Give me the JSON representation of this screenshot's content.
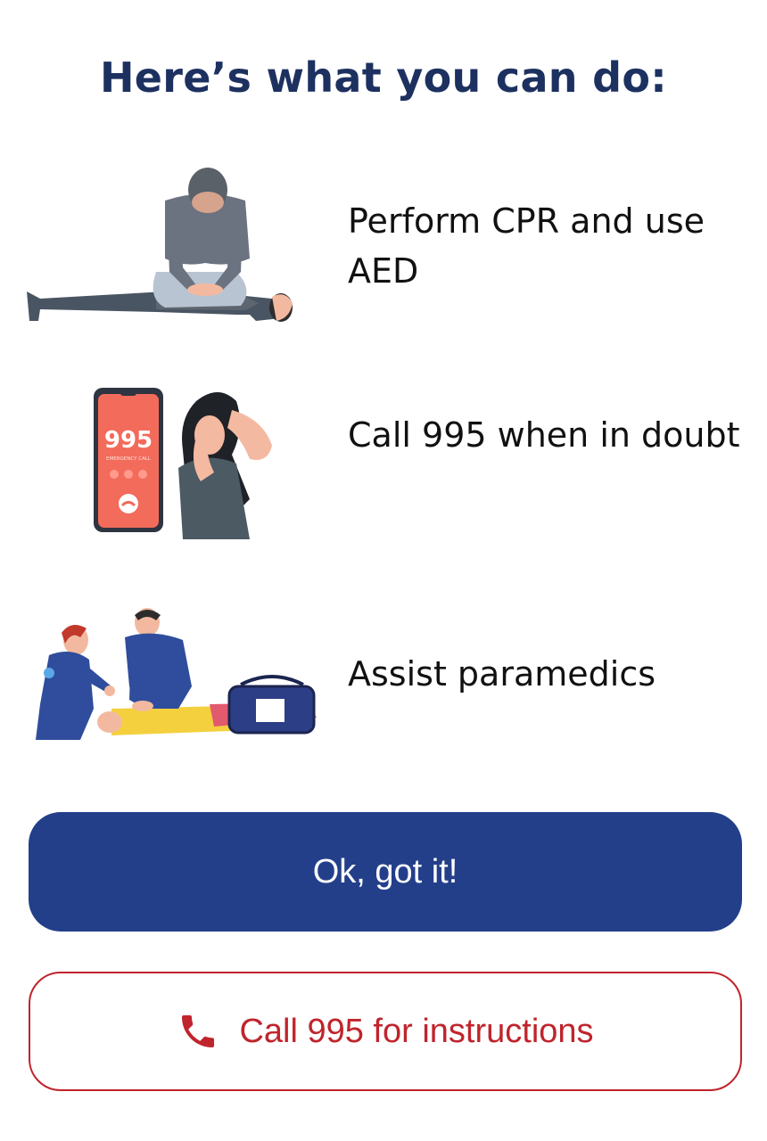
{
  "title": "Here’s what you can do:",
  "actions": [
    {
      "label": "Perform CPR and use AED",
      "icon": "cpr-illustration"
    },
    {
      "label": "Call 995 when in doubt",
      "icon": "emergency-call-illustration",
      "phone_number_display": "995",
      "phone_caption": "EMERGENCY CALL"
    },
    {
      "label": "Assist paramedics",
      "icon": "paramedics-illustration"
    }
  ],
  "buttons": {
    "primary_label": "Ok, got it!",
    "secondary_label": "Call 995 for instructions",
    "secondary_icon": "phone-icon"
  },
  "colors": {
    "title": "#1d3160",
    "primary": "#243f8a",
    "accent_red": "#c0242c",
    "phone_screen": "#f26b5b"
  }
}
